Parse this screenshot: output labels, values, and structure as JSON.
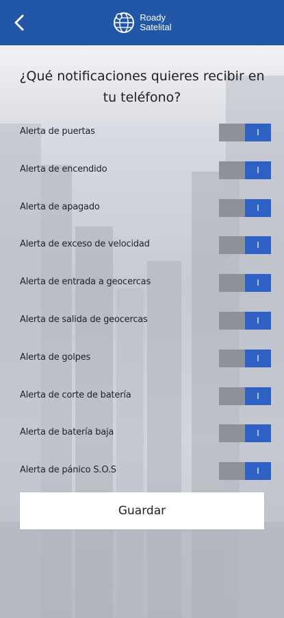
{
  "header": {
    "brand_line1": "Roady",
    "brand_line2": "Satelital",
    "bg_color": "#2257a8"
  },
  "title": "¿Qué notificaciones quieres recibir en tu teléfono?",
  "toggle_on_label": "I",
  "alerts": [
    {
      "label": "Alerta de puertas",
      "enabled": true
    },
    {
      "label": "Alerta de encendido",
      "enabled": true
    },
    {
      "label": "Alerta de apagado",
      "enabled": true
    },
    {
      "label": "Alerta de exceso de velocidad",
      "enabled": true
    },
    {
      "label": "Alerta de entrada a geocercas",
      "enabled": true
    },
    {
      "label": "Alerta de salida de geocercas",
      "enabled": true
    },
    {
      "label": "Alerta de golpes",
      "enabled": true
    },
    {
      "label": "Alerta de corte de batería",
      "enabled": true
    },
    {
      "label": "Alerta de batería baja",
      "enabled": true
    },
    {
      "label": "Alerta de pánico S.O.S",
      "enabled": true
    }
  ],
  "save_label": "Guardar",
  "colors": {
    "toggle_on": "#2f61c4",
    "toggle_off": "#8e9197"
  }
}
